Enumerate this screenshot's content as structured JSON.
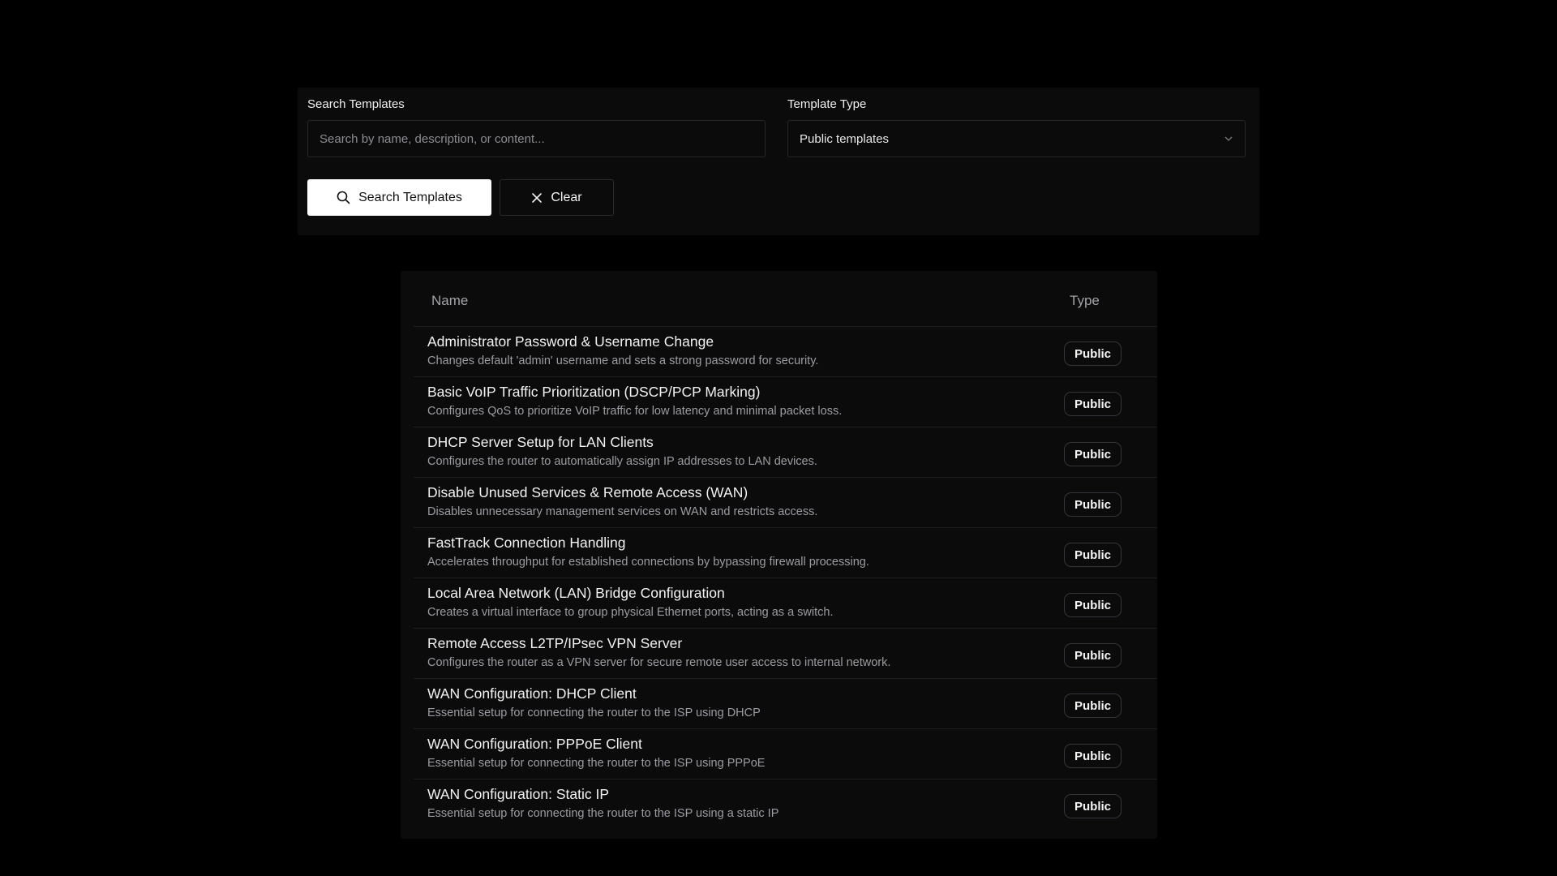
{
  "filters": {
    "search_label": "Search Templates",
    "search_placeholder": "Search by name, description, or content...",
    "search_value": "",
    "type_label": "Template Type",
    "type_selected": "Public templates",
    "search_button_label": "Search Templates",
    "clear_button_label": "Clear"
  },
  "table": {
    "columns": {
      "name": "Name",
      "type": "Type"
    },
    "rows": [
      {
        "title": "Administrator Password & Username Change",
        "description": "Changes default 'admin' username and sets a strong password for security.",
        "type": "Public"
      },
      {
        "title": "Basic VoIP Traffic Prioritization (DSCP/PCP Marking)",
        "description": "Configures QoS to prioritize VoIP traffic for low latency and minimal packet loss.",
        "type": "Public"
      },
      {
        "title": "DHCP Server Setup for LAN Clients",
        "description": "Configures the router to automatically assign IP addresses to LAN devices.",
        "type": "Public"
      },
      {
        "title": "Disable Unused Services & Remote Access (WAN)",
        "description": "Disables unnecessary management services on WAN and restricts access.",
        "type": "Public"
      },
      {
        "title": "FastTrack Connection Handling",
        "description": "Accelerates throughput for established connections by bypassing firewall processing.",
        "type": "Public"
      },
      {
        "title": "Local Area Network (LAN) Bridge Configuration",
        "description": "Creates a virtual interface to group physical Ethernet ports, acting as a switch.",
        "type": "Public"
      },
      {
        "title": "Remote Access L2TP/IPsec VPN Server",
        "description": "Configures the router as a VPN server for secure remote user access to internal network.",
        "type": "Public"
      },
      {
        "title": "WAN Configuration: DHCP Client",
        "description": "Essential setup for connecting the router to the ISP using DHCP",
        "type": "Public"
      },
      {
        "title": "WAN Configuration: PPPoE Client",
        "description": "Essential setup for connecting the router to the ISP using PPPoE",
        "type": "Public"
      },
      {
        "title": "WAN Configuration: Static IP",
        "description": "Essential setup for connecting the router to the ISP using a static IP",
        "type": "Public"
      }
    ]
  },
  "icons": {
    "search": "search-icon",
    "clear": "close-icon",
    "select": "chevron-down-icon"
  },
  "colors": {
    "background": "#000000",
    "panel": "#0b0b0c",
    "primary_button": "#ffffff",
    "muted_text": "#9c9ca2"
  }
}
